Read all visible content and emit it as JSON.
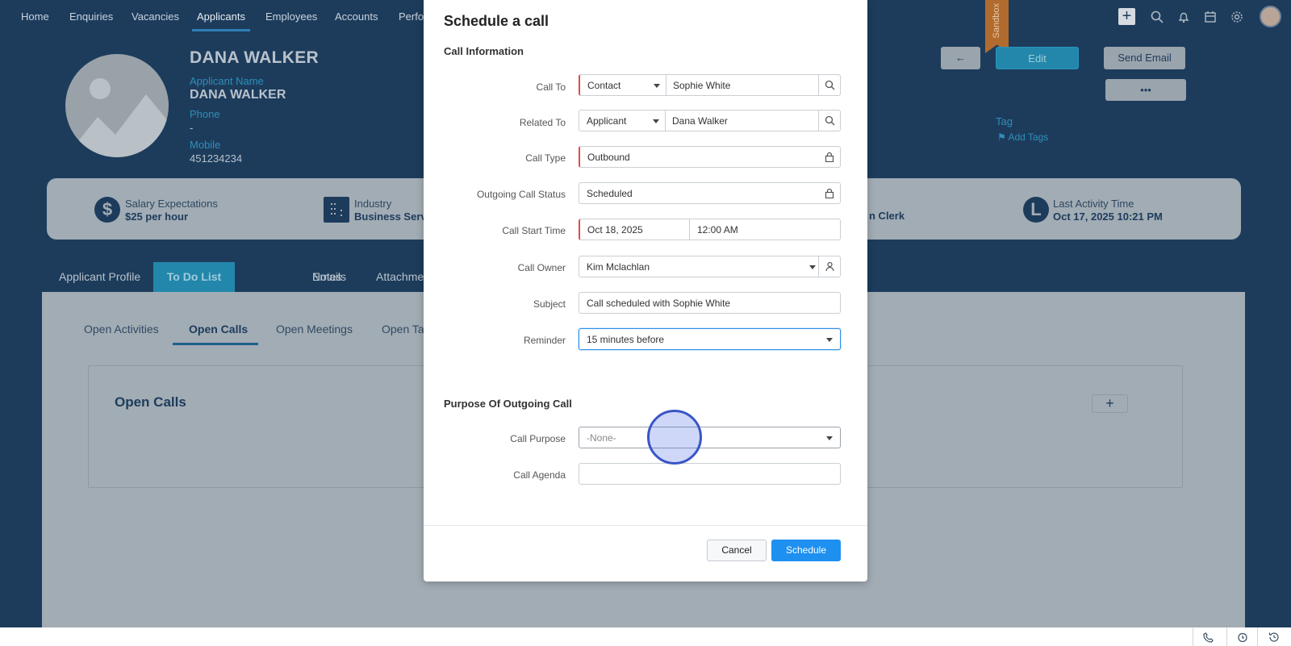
{
  "nav": {
    "items": [
      "Home",
      "Enquiries",
      "Vacancies",
      "Applicants",
      "Employees",
      "Accounts",
      "Perfor"
    ],
    "active_index": 3,
    "sandbox_label": "Sandbox"
  },
  "profile": {
    "name": "DANA WALKER",
    "applicant_name_label": "Applicant Name",
    "applicant_name_value": "DANA WALKER",
    "phone_label": "Phone",
    "phone_value": "-",
    "mobile_label": "Mobile",
    "mobile_value": "451234234"
  },
  "header_actions": {
    "back_icon": "arrow-left-icon",
    "edit_label": "Edit",
    "send_email_label": "Send Email",
    "more_label": "•••",
    "tag_label": "Tag",
    "add_tags_label": "Add Tags"
  },
  "info_strip": {
    "salary_label": "Salary Expectations",
    "salary_value": "$25 per hour",
    "industry_label": "Industry",
    "industry_value": "Business Servic",
    "role_value": "n Clerk",
    "last_activity_label": "Last Activity Time",
    "last_activity_value": "Oct 17, 2025 10:21 PM"
  },
  "tabs": {
    "items": [
      "Applicant Profile",
      "To Do List",
      "Notes",
      "Emails",
      "Attachme"
    ],
    "active": "To Do List"
  },
  "subtabs": {
    "items": [
      "Open Activities",
      "Open Calls",
      "Open Meetings",
      "Open Tas"
    ],
    "active": "Open Calls"
  },
  "open_calls": {
    "title": "Open Calls",
    "add_label": "+"
  },
  "modal": {
    "title": "Schedule a call",
    "section_call_info": "Call Information",
    "call_to_label": "Call To",
    "call_to_type": "Contact",
    "call_to_value": "Sophie White",
    "related_to_label": "Related To",
    "related_to_type": "Applicant",
    "related_to_value": "Dana Walker",
    "call_type_label": "Call Type",
    "call_type_value": "Outbound",
    "call_status_label": "Outgoing Call Status",
    "call_status_value": "Scheduled",
    "start_time_label": "Call Start Time",
    "start_date_value": "Oct 18, 2025",
    "start_time_value": "12:00 AM",
    "owner_label": "Call Owner",
    "owner_value": "Kim Mclachlan",
    "subject_label": "Subject",
    "subject_value": "Call scheduled with Sophie White",
    "reminder_label": "Reminder",
    "reminder_value": "15 minutes before",
    "section_purpose": "Purpose Of Outgoing Call",
    "purpose_label": "Call Purpose",
    "purpose_value": "-None-",
    "agenda_label": "Call Agenda",
    "agenda_value": "",
    "cancel_label": "Cancel",
    "schedule_label": "Schedule"
  },
  "colors": {
    "page_bg": "#1d3c5c",
    "accent": "#2387ab",
    "primary_button": "#1e90f0",
    "mandatory": "#e04b4b"
  }
}
